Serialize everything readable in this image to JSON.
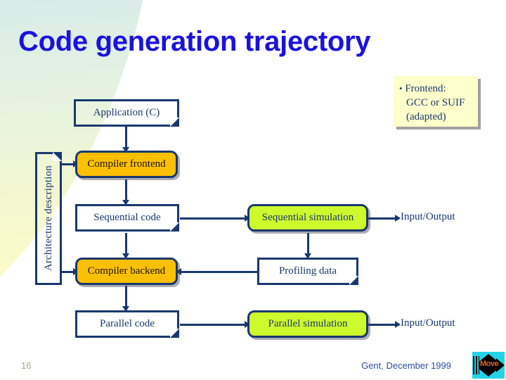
{
  "slide": {
    "title": "Code generation trajectory",
    "number": "16",
    "venue": "Gent, December 1999"
  },
  "logo": {
    "word": "Move"
  },
  "note": {
    "bullet": "•",
    "line1": "Frontend:",
    "line2": "GCC or SUIF",
    "line3": "(adapted)"
  },
  "nodes": {
    "application": "Application (C)",
    "architecture": "Architecture description",
    "compiler_frontend": "Compiler frontend",
    "sequential_code": "Sequential code",
    "compiler_backend": "Compiler backend",
    "parallel_code": "Parallel code",
    "sequential_simulation": "Sequential simulation",
    "profiling_data": "Profiling data",
    "parallel_simulation": "Parallel simulation",
    "io_top": "Input/Output",
    "io_bottom": "Input/Output"
  },
  "colors": {
    "title": "#1a12e0",
    "outline": "#19386e",
    "process_gold": "#fbc004",
    "process_lime": "#cdfa2c",
    "note_bg": "#ffffcc",
    "logo_cyan": "#25d3e8",
    "logo_word": "#e8631c"
  }
}
